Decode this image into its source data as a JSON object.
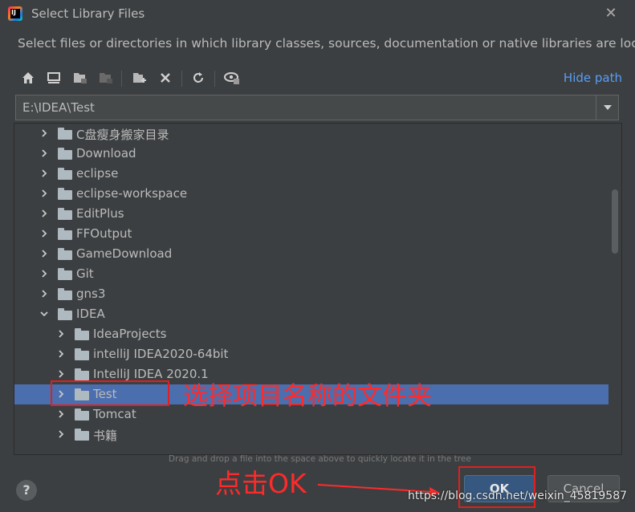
{
  "window": {
    "title": "Select Library Files"
  },
  "description": "Select files or directories in which library classes, sources, documentation or native libraries are located",
  "toolbar": {
    "icons": [
      "home-icon",
      "desktop-icon",
      "project-folder-icon",
      "module-folder-icon",
      "new-folder-icon",
      "delete-icon",
      "refresh-icon",
      "show-hidden-icon"
    ],
    "hide_path_label": "Hide path"
  },
  "path_field": {
    "value": "E:\\IDEA\\Test"
  },
  "tree": {
    "rows": [
      {
        "label": "C盘瘦身搬家目录",
        "level": 0,
        "expanded": false
      },
      {
        "label": "Download",
        "level": 0,
        "expanded": false
      },
      {
        "label": "eclipse",
        "level": 0,
        "expanded": false
      },
      {
        "label": "eclipse-workspace",
        "level": 0,
        "expanded": false
      },
      {
        "label": "EditPlus",
        "level": 0,
        "expanded": false
      },
      {
        "label": "FFOutput",
        "level": 0,
        "expanded": false
      },
      {
        "label": "GameDownload",
        "level": 0,
        "expanded": false
      },
      {
        "label": "Git",
        "level": 0,
        "expanded": false
      },
      {
        "label": "gns3",
        "level": 0,
        "expanded": false
      },
      {
        "label": "IDEA",
        "level": 0,
        "expanded": true
      },
      {
        "label": "IdeaProjects",
        "level": 1,
        "expanded": false
      },
      {
        "label": "intelliJ IDEA2020-64bit",
        "level": 1,
        "expanded": false
      },
      {
        "label": "IntelliJ IDEA 2020.1",
        "level": 1,
        "expanded": false
      },
      {
        "label": "Test",
        "level": 1,
        "expanded": false,
        "selected": true
      },
      {
        "label": "Tomcat",
        "level": 1,
        "expanded": false
      },
      {
        "label": "书籍",
        "level": 1,
        "expanded": false
      }
    ]
  },
  "hint": "Drag and drop a file into the space above to quickly locate it in the tree",
  "footer": {
    "help_label": "?",
    "ok_label": "OK",
    "cancel_label": "Cancel"
  },
  "annotations": {
    "select_note": "选择项目名称的文件夹",
    "ok_note": "点击OK"
  },
  "watermark": "https://blog.csdn.net/weixin_45819587",
  "colors": {
    "selection": "#4b6eaf",
    "link": "#589df6",
    "annotation": "#ff2a2a",
    "ok_button": "#365880"
  }
}
